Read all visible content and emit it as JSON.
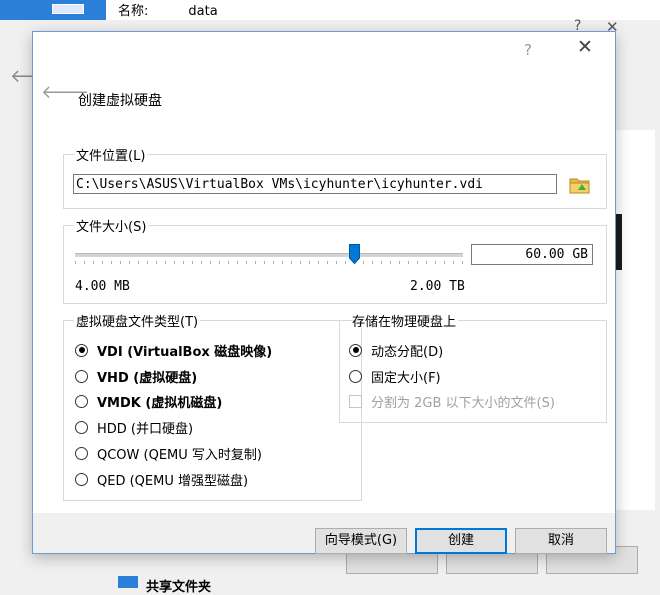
{
  "background": {
    "top_row": {
      "name_label": "名称:",
      "name_value": "data"
    },
    "bottom_item": "共享文件夹"
  },
  "dialog": {
    "title": "创建虚拟硬盘",
    "help_glyph": "?",
    "close_glyph": "✕",
    "file_location": {
      "legend": "文件位置(L)",
      "path": "C:\\Users\\ASUS\\VirtualBox VMs\\icyhunter\\icyhunter.vdi",
      "browse_icon": "folder-icon"
    },
    "file_size": {
      "legend": "文件大小(S)",
      "value": "60.00 GB",
      "min_label": "4.00 MB",
      "max_label": "2.00 TB",
      "slider_fraction": 0.72
    },
    "disk_type": {
      "legend": "虚拟硬盘文件类型(T)",
      "options": [
        {
          "label": "VDI (VirtualBox 磁盘映像)",
          "checked": true,
          "bold": true
        },
        {
          "label": "VHD (虚拟硬盘)",
          "checked": false,
          "bold": true
        },
        {
          "label": "VMDK (虚拟机磁盘)",
          "checked": false,
          "bold": true
        },
        {
          "label": "HDD (并口硬盘)",
          "checked": false,
          "bold": false
        },
        {
          "label": "QCOW (QEMU 写入时复制)",
          "checked": false,
          "bold": false
        },
        {
          "label": "QED (QEMU 增强型磁盘)",
          "checked": false,
          "bold": false
        }
      ]
    },
    "storage": {
      "legend": "存储在物理硬盘上",
      "options": [
        {
          "label": "动态分配(D)",
          "checked": true
        },
        {
          "label": "固定大小(F)",
          "checked": false
        }
      ],
      "split_checkbox": {
        "label": "分割为 2GB 以下大小的文件(S)",
        "checked": false,
        "disabled": true
      }
    },
    "buttons": {
      "guided_mode": "向导模式(G)",
      "create": "创建",
      "cancel": "取消"
    }
  }
}
